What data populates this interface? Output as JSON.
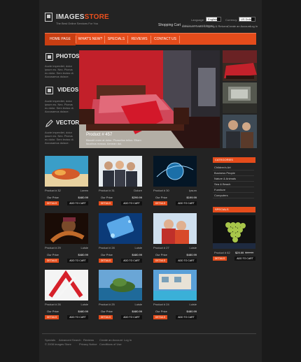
{
  "header": {
    "logo_main": "IMAGES",
    "logo_accent": "STORE",
    "tagline": "The Best Online Services For You",
    "language_label": "Language:",
    "language_value": "English",
    "currency_label": "Currency:",
    "currency_value": "US Dollar",
    "cart_title": "Shopping Cart",
    "cart_note": "(Add to your cart 0 items)",
    "links": [
      "Advanced Search",
      "Shipping & Returns",
      "Create an Account",
      "Log In"
    ]
  },
  "nav": [
    "HOME PAGE",
    "WHAT'S NEW?",
    "SPECIALS",
    "REVIEWS",
    "CONTACT US"
  ],
  "sidebar": [
    {
      "title": "PHOTOS",
      "text": "Aucte imperdiet, dolor ipsum eu. Nec. Piceus eu dolor. Sem lectus di. Accusamus dulace."
    },
    {
      "title": "VIDEOS",
      "text": "Aucte imperdiet, dolor ipsum eu. Nec. Piceus eu dolor. Sem lectus di. Accusamus dulace."
    },
    {
      "title": "VECTOR",
      "text": "Aucte imperdiet, dolor ipsum eu. Nec. Piceus eu dolor. Sem lectus di. Accusamus dulace."
    }
  ],
  "hero": {
    "product": "Product # 457",
    "caption": "Blandit enim at dolor. Phasellus tellus. Etiam faucibus massa. Aenean dui."
  },
  "products": [
    {
      "id": "Product # 32",
      "label": "Lorem",
      "price_label": "Our Price",
      "price": "$480.99"
    },
    {
      "id": "Product # 31",
      "label": "Dolore",
      "price_label": "Our Price",
      "price": "$299.99"
    },
    {
      "id": "Product # 30",
      "label": "Ipsum",
      "price_label": "Our Price",
      "price": "$199.99"
    },
    {
      "id": "Product # 29",
      "label": "Luisle",
      "price_label": "Our Price",
      "price": "$480.99"
    },
    {
      "id": "Product # 28",
      "label": "Luisle",
      "price_label": "Our Price",
      "price": "$480.99"
    },
    {
      "id": "Product # 27",
      "label": "Luisle",
      "price_label": "Our Price",
      "price": "$480.99"
    },
    {
      "id": "Product # 26",
      "label": "Luisle",
      "price_label": "Our Price",
      "price": "$480.99"
    },
    {
      "id": "Product # 25",
      "label": "Luisle",
      "price_label": "Our Price",
      "price": "$480.99"
    },
    {
      "id": "Product # 24",
      "label": "Luisle",
      "price_label": "Our Price",
      "price": "$480.99"
    }
  ],
  "buttons": {
    "details": "DETAILS",
    "add": "ADD TO CART"
  },
  "categories": {
    "title": "CATEGORIES",
    "items": [
      "Children's Art",
      "Business People",
      "Nature & Animals",
      "Sea & Beach",
      "Furniture",
      "Computers"
    ]
  },
  "specials": {
    "title": "SPECIALS",
    "id": "Product # 62",
    "price_new": "$29.99",
    "price_old": "$50.99",
    "details": "DETAILS",
    "add": "ADD TO CART"
  },
  "footer": {
    "links": [
      "Specials",
      "Advanced Search",
      "Reviews",
      "Create an Account",
      "Log In"
    ],
    "copyright": "© 2008 Images Store",
    "privacy": "Privacy Notice",
    "conditions": "Conditions of Use"
  },
  "colors": {
    "accent": "#e54c1b",
    "background": "#1a1a1a"
  }
}
